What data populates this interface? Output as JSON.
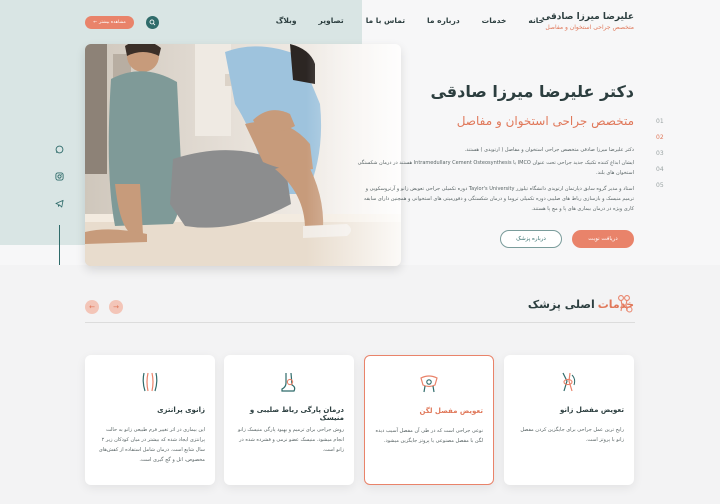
{
  "header": {
    "brand_name": "علیرضا میرزا صادقی",
    "brand_sub": "متخصص جراحی استخوان و مفاصل",
    "nav": [
      "خانه",
      "خدمات",
      "درباره ما",
      "تماس با ما",
      "تصاویر",
      "وبلاگ"
    ],
    "consult_label": "مشاهده بیشتر",
    "search_icon": "search-icon"
  },
  "hero": {
    "title": "دکتر علیرضا میرزا صادقی",
    "subtitle": "متخصص جراحی استخوان و مفاصل",
    "para1": "دکتر علیرضا میرزا صادقی متخصص جراحی استخوان و مفاصل ( ارتوپدی ) هستند.",
    "para2": "ایشان ابداع کننده تکنیک جدید جراحی تحت عنوان IMCO یا Intramedullary Cement Osteosynthesis هستند در درمان شکستگی استخوان های بلند.",
    "para3": "استاد و مدیر گروه سابق دپارتمان ارتوپدی دانشگاه تیلوزر Taylor's University دوره تکمیلی جراحی تعویض زانو و آرتروسکوپی و ترمیم منیسک و بازسازی رباط های صلیبی دوره تکمیلی تروما و درمان شکستگی و دفورمیتی های استخوانی و همچنین دارای سابقه کاری ویژه در درمان بیماری های پا و مچ پا هستند.",
    "btn_primary": "دریافت نوبت",
    "btn_secondary": "درباره پزشک",
    "slides": [
      "01",
      "02",
      "03",
      "04",
      "05"
    ],
    "active_slide": "02"
  },
  "socials": [
    "whatsapp-icon",
    "instagram-icon",
    "telegram-icon"
  ],
  "services": {
    "title_pre": "خدمات",
    "title_post": "اصلی پزشک",
    "prev_arrow": "←",
    "next_arrow": "→",
    "cards": [
      {
        "title": "تعویض مفصل زانو",
        "text": "رایج ترین عمل جراحی برای جایگزین کردن مفصل زانو با پروتز است.",
        "icon": "knee-icon"
      },
      {
        "title": "تعویض مفصل لگن",
        "text": "نوعی جراحی است که در طی آن مفصل آسیب دیده لگن با مفصل مصنوعی یا پروتز جایگزین میشود.",
        "icon": "hip-icon"
      },
      {
        "title": "درمان پارگی رباط صلیبی و منیسک",
        "text": "روش جراحی برای ترمیم و بهبود پارگی منیسک زانو انجام میشود. منیسک عضو نرمی و فشرده شده در زانو است.",
        "icon": "ligament-icon"
      },
      {
        "title": "زانوی پرانتزی",
        "text": "این بیماری در اثر تغییر فرم طبیعی زانو به حالت پرانتزی ایجاد شده که بیشتر در میان کودکان زیر ۲ سال شایع است. درمان شامل استفاده از کفش‌های مخصوص، اتل و گچ گیری است.",
        "icon": "bowleg-icon"
      }
    ]
  },
  "colors": {
    "accent": "#e9836a",
    "primary": "#2f6b6a",
    "hero_bg": "#d9e5e4"
  }
}
